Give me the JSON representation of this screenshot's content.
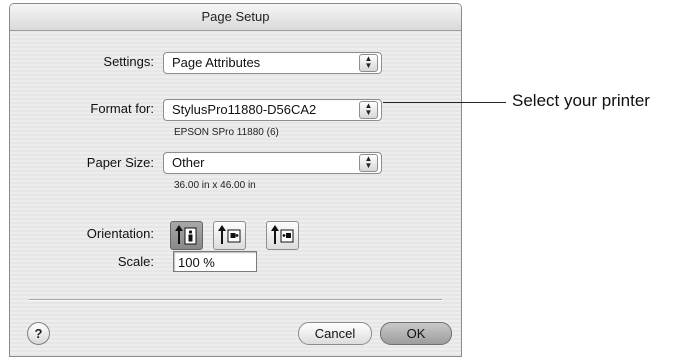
{
  "dialog": {
    "title": "Page Setup",
    "settings_label": "Settings:",
    "settings_value": "Page Attributes",
    "format_label": "Format for:",
    "format_value": "StylusPro11880-D56CA2",
    "format_sub": "EPSON SPro 11880 (6)",
    "paper_label": "Paper Size:",
    "paper_value": "Other",
    "paper_sub": "36.00 in x 46.00 in",
    "orientation_label": "Orientation:",
    "orientation_selected": "portrait",
    "scale_label": "Scale:",
    "scale_value": "100 %",
    "help_label": "?",
    "cancel_label": "Cancel",
    "ok_label": "OK"
  },
  "callout": {
    "text": "Select your printer"
  },
  "icons": {
    "popup_arrows": "up-down-arrows-icon",
    "orientation": [
      "portrait-icon",
      "landscape-left-icon",
      "landscape-right-icon"
    ]
  }
}
